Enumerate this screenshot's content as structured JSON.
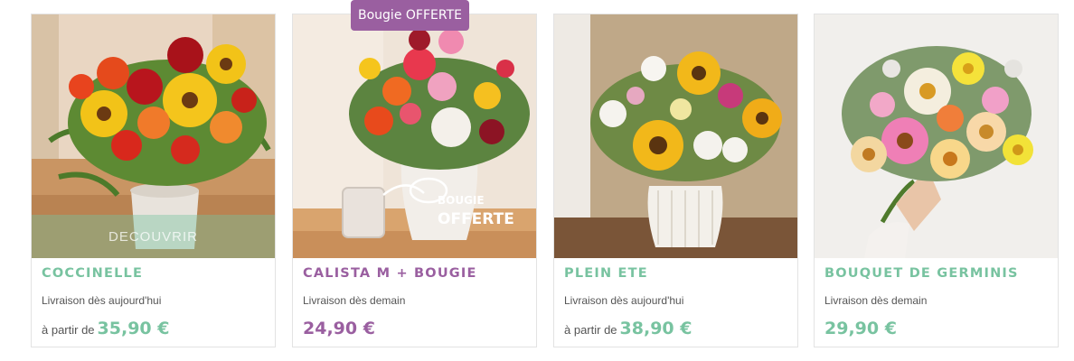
{
  "products": [
    {
      "name": "COCCINELLE",
      "delivery": "Livraison dès aujourd'hui",
      "price_prefix": "à partir de",
      "price": "35,90 €",
      "hover_label": "DECOUVRIR",
      "image": "bouquet-red-yellow-photo",
      "accent": "#78c3a0"
    },
    {
      "name": "CALISTA M + BOUGIE",
      "delivery": "Livraison dès demain",
      "price": "24,90 €",
      "badge": "Bougie OFFERTE",
      "image_text_1": "BOUGIE",
      "image_text_2": "OFFERTE",
      "image": "bouquet-with-candle-photo",
      "accent": "#9a5fa0"
    },
    {
      "name": "PLEIN ETE",
      "delivery": "Livraison dès aujourd'hui",
      "price_prefix": "à partir de",
      "price": "38,90 €",
      "image": "bouquet-sunflowers-photo",
      "accent": "#78c3a0"
    },
    {
      "name": "BOUQUET DE GERMINIS",
      "delivery": "Livraison dès demain",
      "price": "29,90 €",
      "image": "bouquet-germinis-photo",
      "accent": "#78c3a0"
    }
  ]
}
